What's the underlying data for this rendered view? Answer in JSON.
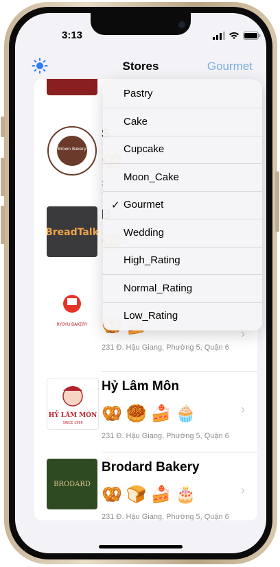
{
  "status": {
    "time": "3:13"
  },
  "nav": {
    "title": "Stores",
    "filter_label": "Gourmet",
    "left_icon": "sun-icon"
  },
  "menu": {
    "items": [
      {
        "label": "Pastry",
        "checked": false
      },
      {
        "label": "Cake",
        "checked": false
      },
      {
        "label": "Cupcake",
        "checked": false
      },
      {
        "label": "Moon_Cake",
        "checked": false
      },
      {
        "label": "Gourmet",
        "checked": true
      },
      {
        "label": "Wedding",
        "checked": false
      },
      {
        "label": "High_Rating",
        "checked": false
      },
      {
        "label": "Normal_Rating",
        "checked": false
      },
      {
        "label": "Low_Rating",
        "checked": false
      }
    ],
    "check_glyph": "✓"
  },
  "stores": [
    {
      "name": "",
      "address": "",
      "logo_text": "",
      "icons": []
    },
    {
      "name": "S",
      "address": "3",
      "logo_text": "Brown Bakery",
      "logo_sub": "1996",
      "icons": [
        "🥨"
      ]
    },
    {
      "name": "B",
      "address": "",
      "logo_text": "BreadTalk",
      "icons": [
        "🥨"
      ]
    },
    {
      "name": "",
      "address": "231 Đ. Hậu Giang, Phường 5, Quận 6",
      "logo_text": "RYOYU BAKERY",
      "icons": [
        "🥨",
        "🍰"
      ]
    },
    {
      "name": "Hỷ Lâm Môn",
      "address": "231 Đ. Hậu Giang, Phường 5, Quận 6",
      "logo_text": "HỶ LÂM MÔN",
      "logo_sub": "SINCE 1996",
      "icons": [
        "🥨",
        "🥮",
        "🍰",
        "🧁"
      ]
    },
    {
      "name": "Brodard Bakery",
      "address": "231 Đ. Hậu Giang, Phường 5, Quận 6",
      "logo_text": "BRODARD",
      "icons": [
        "🥨",
        "🍞",
        "🍰",
        "🎂"
      ]
    }
  ],
  "colors": {
    "accent": "#7aaee0",
    "breadtalk_bg": "#3a3a3c",
    "brodard_bg": "#2e4a23",
    "hylammon_red": "#b3232b"
  }
}
